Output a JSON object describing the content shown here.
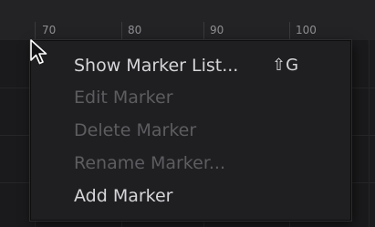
{
  "ruler": {
    "labels": [
      "70",
      "80",
      "90",
      "100"
    ]
  },
  "context_menu": {
    "items": [
      {
        "label": "Show Marker List...",
        "shortcut": "⇧G",
        "enabled": true
      },
      {
        "label": "Edit Marker",
        "enabled": false
      },
      {
        "label": "Delete Marker",
        "enabled": false
      },
      {
        "label": "Rename Marker...",
        "enabled": false
      },
      {
        "label": "Add Marker",
        "enabled": true
      }
    ]
  },
  "colors": {
    "enabled_text": "#d6d6da",
    "disabled_text": "#5d5d61",
    "menu_background": "#1f1f21"
  },
  "cursor_icon": "arrow-pointer-icon"
}
